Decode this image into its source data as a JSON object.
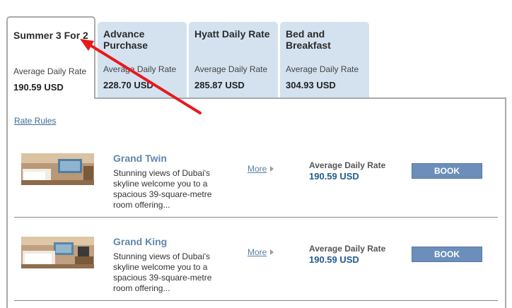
{
  "tabs": [
    {
      "title": "Summer 3 For 2",
      "label": "Average Daily Rate",
      "price": "190.59 USD"
    },
    {
      "title": "Advance Purchase",
      "label": "Average Daily Rate",
      "price": "228.70 USD"
    },
    {
      "title": "Hyatt Daily Rate",
      "label": "Average Daily Rate",
      "price": "285.87 USD"
    },
    {
      "title": "Bed and Breakfast",
      "label": "Average Daily Rate",
      "price": "304.93 USD"
    }
  ],
  "rate_rules_label": "Rate Rules",
  "rooms": [
    {
      "name": "Grand Twin",
      "description": "Stunning views of Dubai's skyline welcome you to a spacious 39-square-metre room offering...",
      "more_label": "More",
      "avg_label": "Average Daily Rate",
      "price": "190.59 USD",
      "book_label": "BOOK"
    },
    {
      "name": "Grand King",
      "description": "Stunning views of Dubai's skyline welcome you to a spacious 39-square-metre room offering...",
      "more_label": "More",
      "avg_label": "Average Daily Rate",
      "price": "190.59 USD",
      "book_label": "BOOK"
    }
  ],
  "colors": {
    "tab_background": "#d4e2f0",
    "accent_blue": "#235d8f",
    "book_button": "#6b8fba",
    "annotation_arrow": "#e8191c"
  }
}
